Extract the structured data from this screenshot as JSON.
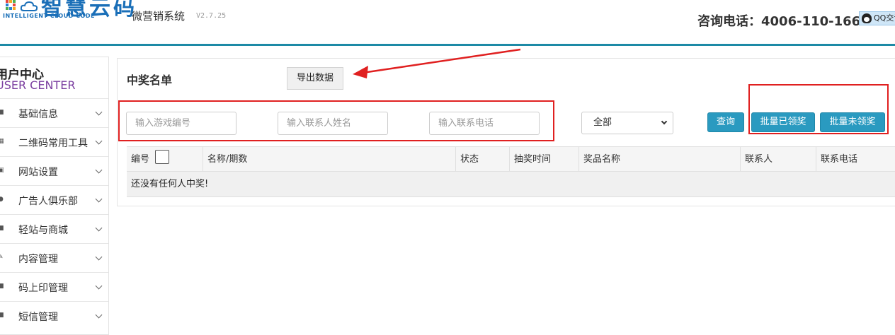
{
  "header": {
    "logo_text": "智慧云码",
    "logo_sub": "INTELLIGENT CLOUD CODE",
    "system_name": "微营销系统",
    "version": "V2.7.25",
    "phone_label": "咨询电话：4006-110-166",
    "qq_label": "QQ交谈"
  },
  "sidebar": {
    "title": "用户中心",
    "subtitle": "USER CENTER",
    "items": [
      {
        "label": "基础信息",
        "icon": "square-icon"
      },
      {
        "label": "二维码常用工具",
        "icon": "qr-icon"
      },
      {
        "label": "网站设置",
        "icon": "window-icon"
      },
      {
        "label": "广告人俱乐部",
        "icon": "person-icon"
      },
      {
        "label": "轻站与商城",
        "icon": "store-icon"
      },
      {
        "label": "内容管理",
        "icon": "edit-icon"
      },
      {
        "label": "码上印管理",
        "icon": "print-icon"
      },
      {
        "label": "短信管理",
        "icon": "message-icon"
      }
    ]
  },
  "main": {
    "title": "中奖名单",
    "export_label": "导出数据",
    "filters": {
      "game_no_placeholder": "输入游戏编号",
      "contact_name_placeholder": "输入联系人姓名",
      "contact_phone_placeholder": "输入联系电话",
      "status_selected": "全部",
      "status_options": [
        "全部"
      ]
    },
    "buttons": {
      "query": "查询",
      "batch_claimed": "批量已领奖",
      "batch_unclaimed": "批量未领奖"
    },
    "table": {
      "columns": [
        "编号",
        "名称/期数",
        "状态",
        "抽奖时间",
        "奖品名称",
        "联系人",
        "联系电话"
      ],
      "empty_message": "还没有任何人中奖!"
    }
  },
  "colors": {
    "accent": "#2a9ac0",
    "header_line": "#1d8aa6",
    "annotation": "#e02020"
  }
}
